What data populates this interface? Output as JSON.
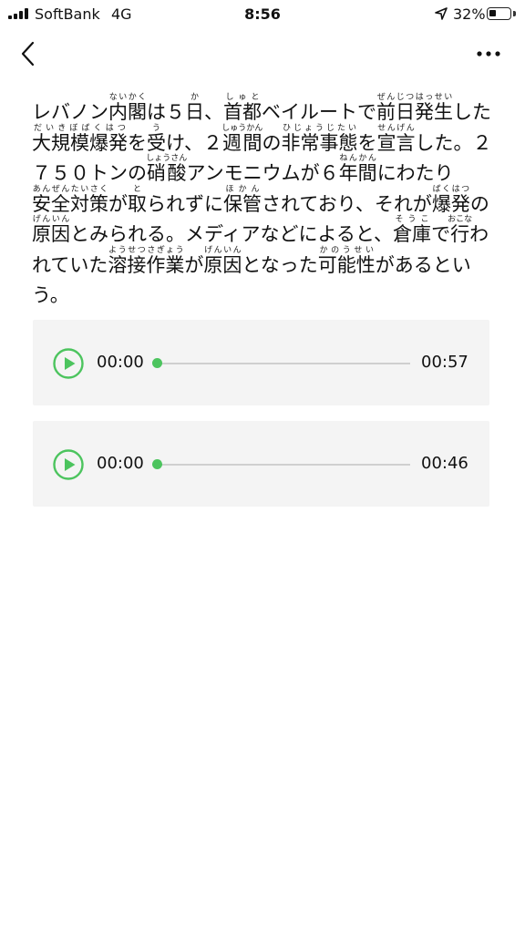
{
  "status": {
    "carrier": "SoftBank",
    "network": "4G",
    "time": "8:56",
    "battery_pct": "32%",
    "battery_level": 0.32,
    "icons": {
      "signal": "signal-bars-icon",
      "location": "location-arrow-icon",
      "battery": "battery-icon"
    }
  },
  "nav": {
    "back_icon": "chevron-left-icon",
    "more_icon": "more-dots-icon"
  },
  "article": {
    "segments": [
      {
        "t": "レバノン"
      },
      {
        "k": "内閣",
        "r": "ないかく"
      },
      {
        "t": "は５"
      },
      {
        "k": "日",
        "r": "か"
      },
      {
        "t": "、"
      },
      {
        "k": "首都",
        "r": "しゅと"
      },
      {
        "t": "ベイルートで"
      },
      {
        "k": "前日発生",
        "r": "ぜんじつはっせい"
      },
      {
        "t": "した"
      },
      {
        "k": "大規模爆発",
        "r": "だいきぼばくはつ"
      },
      {
        "t": "を"
      },
      {
        "k": "受",
        "r": "う"
      },
      {
        "t": "け、２"
      },
      {
        "k": "週間",
        "r": "しゅうかん"
      },
      {
        "t": "の"
      },
      {
        "k": "非常事態",
        "r": "ひじょうじたい"
      },
      {
        "t": "を"
      },
      {
        "k": "宣言",
        "r": "せんげん"
      },
      {
        "t": "した。２７５０トンの"
      },
      {
        "k": "硝酸",
        "r": "しょうさん"
      },
      {
        "t": "アンモニウムが６"
      },
      {
        "k": "年間",
        "r": "ねんかん"
      },
      {
        "t": "にわたり"
      },
      {
        "k": "安全対策",
        "r": "あんぜんたいさく"
      },
      {
        "t": "が"
      },
      {
        "k": "取",
        "r": "と"
      },
      {
        "t": "られずに"
      },
      {
        "k": "保管",
        "r": "ほかん"
      },
      {
        "t": "されており、それが"
      },
      {
        "k": "爆発",
        "r": "ばくはつ"
      },
      {
        "t": "の"
      },
      {
        "k": "原因",
        "r": "げんいん"
      },
      {
        "t": "とみられる。メディアなどによると、"
      },
      {
        "k": "倉庫",
        "r": "そうこ"
      },
      {
        "t": "で"
      },
      {
        "k": "行",
        "r": "おこな"
      },
      {
        "t": "われていた"
      },
      {
        "k": "溶接作業",
        "r": "ようせつさぎょう"
      },
      {
        "t": "が"
      },
      {
        "k": "原因",
        "r": "げんいん"
      },
      {
        "t": "となった"
      },
      {
        "k": "可能性",
        "r": "かのうせい"
      },
      {
        "t": "があるという。"
      }
    ]
  },
  "players": [
    {
      "current": "00:00",
      "duration": "00:57",
      "progress": 0,
      "icon": "play-icon"
    },
    {
      "current": "00:00",
      "duration": "00:46",
      "progress": 0,
      "icon": "play-icon"
    }
  ],
  "colors": {
    "accent": "#4cc45e",
    "card_bg": "#f4f4f4",
    "track": "#cfcfcf"
  }
}
